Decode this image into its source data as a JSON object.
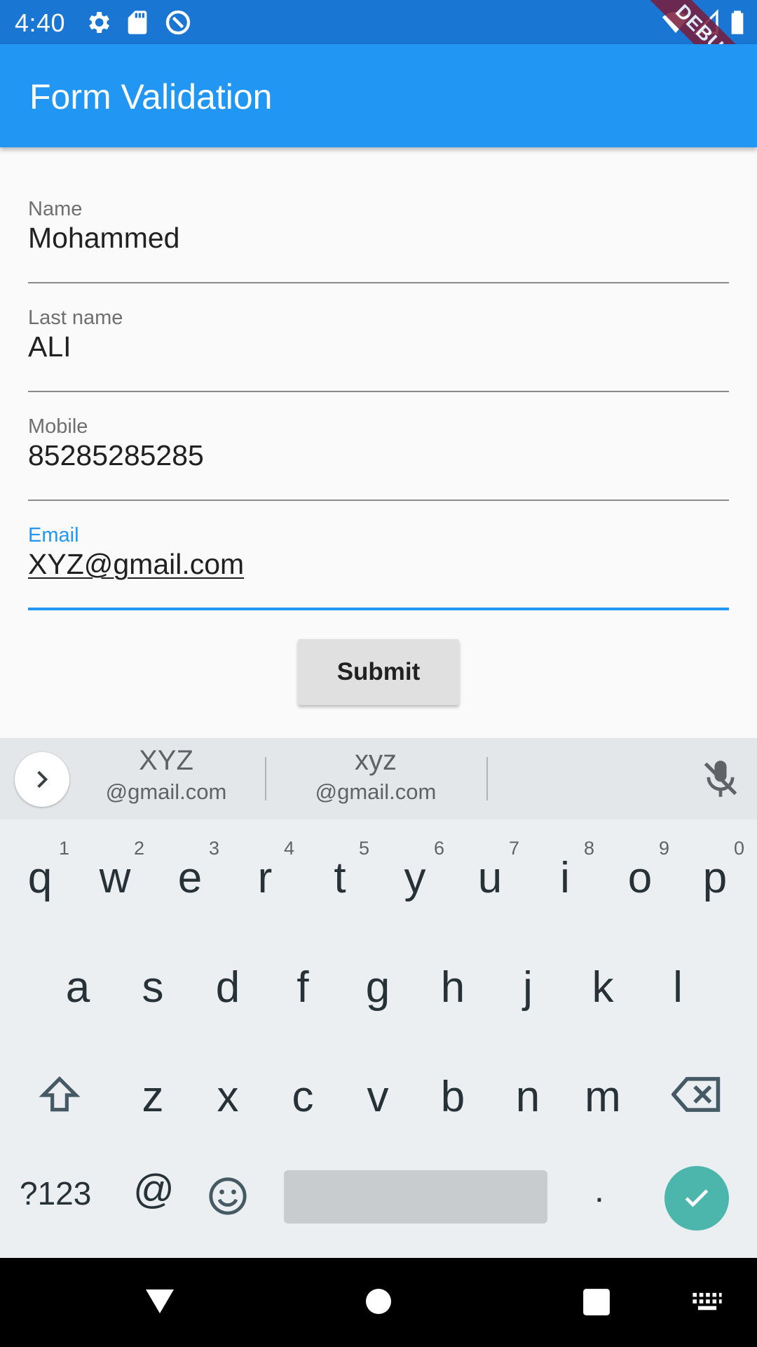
{
  "status_bar": {
    "time": "4:40",
    "icons": [
      "gear-icon",
      "sd-card-icon",
      "no-sim-alert-icon",
      "wifi-icon",
      "signal-icon",
      "battery-icon"
    ],
    "ribbon": "DEBUG"
  },
  "app_bar": {
    "title": "Form Validation",
    "color": "#2196f3"
  },
  "form": {
    "fields": [
      {
        "label": "Name",
        "value": "Mohammed"
      },
      {
        "label": "Last name",
        "value": "ALI"
      },
      {
        "label": "Mobile",
        "value": "85285285285"
      },
      {
        "label": "Email",
        "value": "XYZ@gmail.com"
      }
    ],
    "focused_field": "Email",
    "submit_label": "Submit"
  },
  "keyboard": {
    "suggestions": [
      {
        "main": "XYZ",
        "sub": "@gmail.com"
      },
      {
        "main": "xyz",
        "sub": "@gmail.com"
      }
    ],
    "row1": [
      "q",
      "w",
      "e",
      "r",
      "t",
      "y",
      "u",
      "i",
      "o",
      "p"
    ],
    "row1_hints": [
      "1",
      "2",
      "3",
      "4",
      "5",
      "6",
      "7",
      "8",
      "9",
      "0"
    ],
    "row2": [
      "a",
      "s",
      "d",
      "f",
      "g",
      "h",
      "j",
      "k",
      "l"
    ],
    "row3": [
      "z",
      "x",
      "c",
      "v",
      "b",
      "n",
      "m"
    ],
    "symbols_label": "?123",
    "at_label": "@",
    "period_label": ".",
    "accent_color": "#4db6ac"
  },
  "nav_bar": {
    "icons": [
      "back-icon",
      "home-icon",
      "recents-icon",
      "keyboard-switch-icon"
    ]
  }
}
